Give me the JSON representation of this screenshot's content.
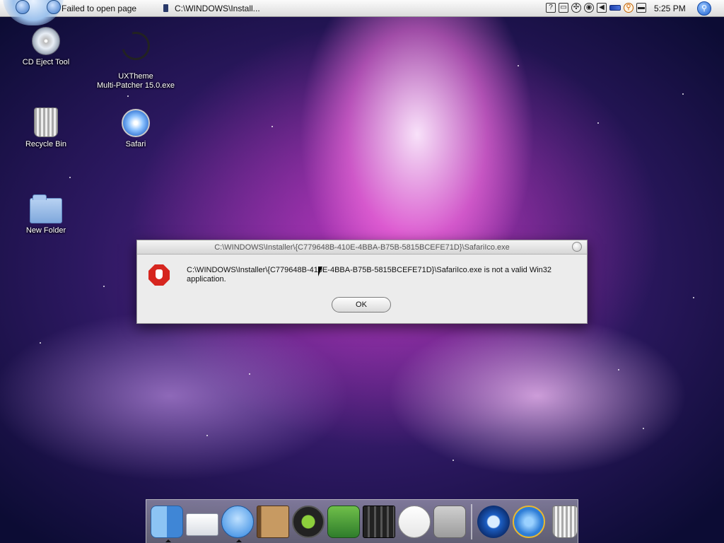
{
  "menubar": {
    "task_1": "Failed to open page",
    "task_2": "C:\\WINDOWS\\Install...",
    "tray_icons": [
      "help-icon",
      "monitor-icon",
      "network-icon",
      "cd-icon",
      "volume-icon",
      "battery-icon",
      "search-icon",
      "display-icon"
    ],
    "clock": "5:25 PM"
  },
  "desktop": {
    "icons": [
      {
        "label": "CD Eject Tool"
      },
      {
        "label": "UXTheme\nMulti-Patcher 15.0.exe"
      },
      {
        "label": "Recycle Bin"
      },
      {
        "label": "Safari"
      },
      {
        "label": "New Folder"
      }
    ]
  },
  "dialog": {
    "title": "C:\\WINDOWS\\Installer\\{C779648B-410E-4BBA-B75B-5815BCEFE71D}\\SafariIco.exe",
    "message": "C:\\WINDOWS\\Installer\\{C779648B-410E-4BBA-B75B-5815BCEFE71D}\\SafariIco.exe is not a valid Win32 application.",
    "ok_label": "OK"
  },
  "dock": {
    "items": [
      "Finder",
      "Mail",
      "iChat",
      "Address Book",
      "iTunes",
      "iPhoto",
      "iMovie",
      "iCal",
      "Utilities",
      "QuickTime",
      "Internet Explorer",
      "Trash"
    ]
  }
}
